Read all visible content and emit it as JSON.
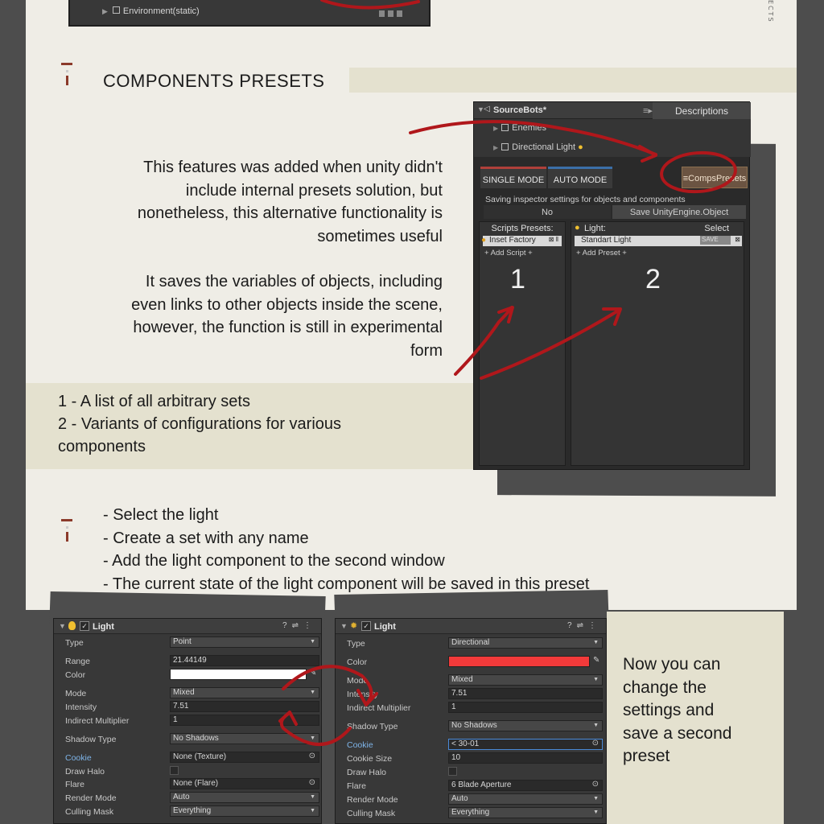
{
  "side_label": "ECTS",
  "top_shot": {
    "item": "Environment(static)"
  },
  "section1": {
    "title": "COMPONENTS PRESETS",
    "para1": [
      "This features was added when unity didn't",
      "include internal presets solution, but",
      "nonetheless, this alternative functionality is",
      "sometimes useful"
    ],
    "para2": [
      "It saves the variables of objects, including",
      "even links to other objects inside the scene,",
      "however, the function is still in experimental",
      "form"
    ],
    "list": [
      "1 - A list of all arbitrary sets",
      "2 - Variants of configurations for various",
      "components"
    ]
  },
  "editor": {
    "hierarchy_title": "SourceBots*",
    "descriptions_label": "Descriptions",
    "items": [
      "Enemies",
      "Directional Light"
    ],
    "tab_single": "SINGLE MODE",
    "tab_auto": "AUTO MODE",
    "tab_comps": "≡CompsPresets",
    "info": "Saving inspector settings for objects and components",
    "no_label": "No",
    "save_label": "Save UnityEngine.Object",
    "scripts_header": "Scripts Presets:",
    "script_item": "Inset Factory",
    "add_script": "+ Add Script +",
    "light_header": "Light:",
    "select_label": "Select",
    "preset_item": "Standart Light",
    "preset_save": "SAVE",
    "add_preset": "+ Add Preset +",
    "num1": "1",
    "num2": "2"
  },
  "section2": {
    "steps": [
      "- Select the light",
      "- Create a set with any name",
      "- Add the light component to the second window",
      "- The current state of the light component will be saved in this preset"
    ]
  },
  "inspector1": {
    "title": "Light",
    "rows": [
      {
        "label": "Type",
        "value": "Point"
      },
      {
        "label": "Range",
        "value": "21.44149"
      },
      {
        "label": "Color",
        "value": ""
      },
      {
        "label": "Mode",
        "value": "Mixed"
      },
      {
        "label": "Intensity",
        "value": "7.51"
      },
      {
        "label": "Indirect Multiplier",
        "value": "1"
      },
      {
        "label": "Shadow Type",
        "value": "No Shadows"
      },
      {
        "label": "Cookie",
        "value": "None (Texture)"
      },
      {
        "label": "Draw Halo",
        "value": ""
      },
      {
        "label": "Flare",
        "value": "None (Flare)"
      },
      {
        "label": "Render Mode",
        "value": "Auto"
      },
      {
        "label": "Culling Mask",
        "value": "Everything"
      }
    ],
    "color_swatch": "#ffffff"
  },
  "inspector2": {
    "title": "Light",
    "rows": [
      {
        "label": "Type",
        "value": "Directional"
      },
      {
        "label": "Color",
        "value": ""
      },
      {
        "label": "Mode",
        "value": "Mixed"
      },
      {
        "label": "Intensity",
        "value": "7.51"
      },
      {
        "label": "Indirect Multiplier",
        "value": "1"
      },
      {
        "label": "Shadow Type",
        "value": "No Shadows"
      },
      {
        "label": "Cookie",
        "value": "< 30-01"
      },
      {
        "label": "Cookie Size",
        "value": "10"
      },
      {
        "label": "Draw Halo",
        "value": ""
      },
      {
        "label": "Flare",
        "value": "6 Blade Aperture"
      },
      {
        "label": "Render Mode",
        "value": "Auto"
      },
      {
        "label": "Culling Mask",
        "value": "Everything"
      }
    ],
    "color_swatch": "#f23a3a"
  },
  "bottom_text": [
    "Now you can",
    "change the",
    "settings and",
    "save a second",
    "preset"
  ],
  "colors": {
    "accent_red": "#b0171b",
    "band": "#e4e1cf",
    "page": "#efede6"
  }
}
